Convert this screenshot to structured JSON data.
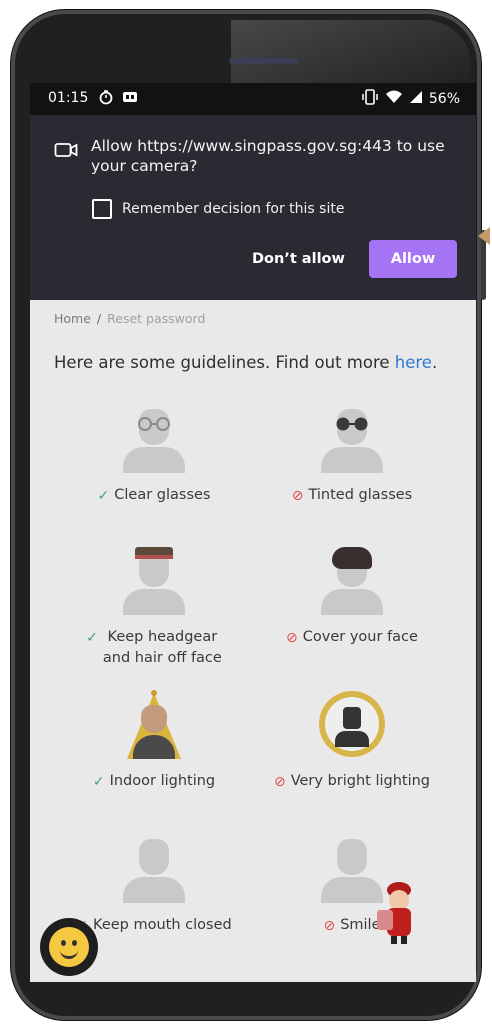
{
  "status_bar": {
    "time": "01:15",
    "battery": "56%"
  },
  "permission_prompt": {
    "message": "Allow https://www.singpass.gov.sg:443 to use your camera?",
    "remember_label": "Remember decision for this site",
    "remember_checked": false,
    "dont_allow_label": "Don’t allow",
    "allow_label": "Allow",
    "allow_color": "#a574f5",
    "panel_color": "#2b2a33"
  },
  "breadcrumb": {
    "home": "Home",
    "separator": "/",
    "current": "Reset password"
  },
  "guidelines": {
    "text": "Here are some guidelines. Find out more",
    "link": "here",
    "suffix": "."
  },
  "items": [
    {
      "label": "Clear glasses",
      "status": "ok"
    },
    {
      "label": "Tinted glasses",
      "status": "no"
    },
    {
      "label_line1": "Keep headgear",
      "label_line2": "and hair off face",
      "status": "ok"
    },
    {
      "label": "Cover your face",
      "status": "no"
    },
    {
      "label": "Indoor lighting",
      "status": "ok"
    },
    {
      "label": "Very bright lighting",
      "status": "no"
    },
    {
      "label": "Keep mouth closed",
      "status": "ok"
    },
    {
      "label": "Smile",
      "status": "no"
    }
  ]
}
